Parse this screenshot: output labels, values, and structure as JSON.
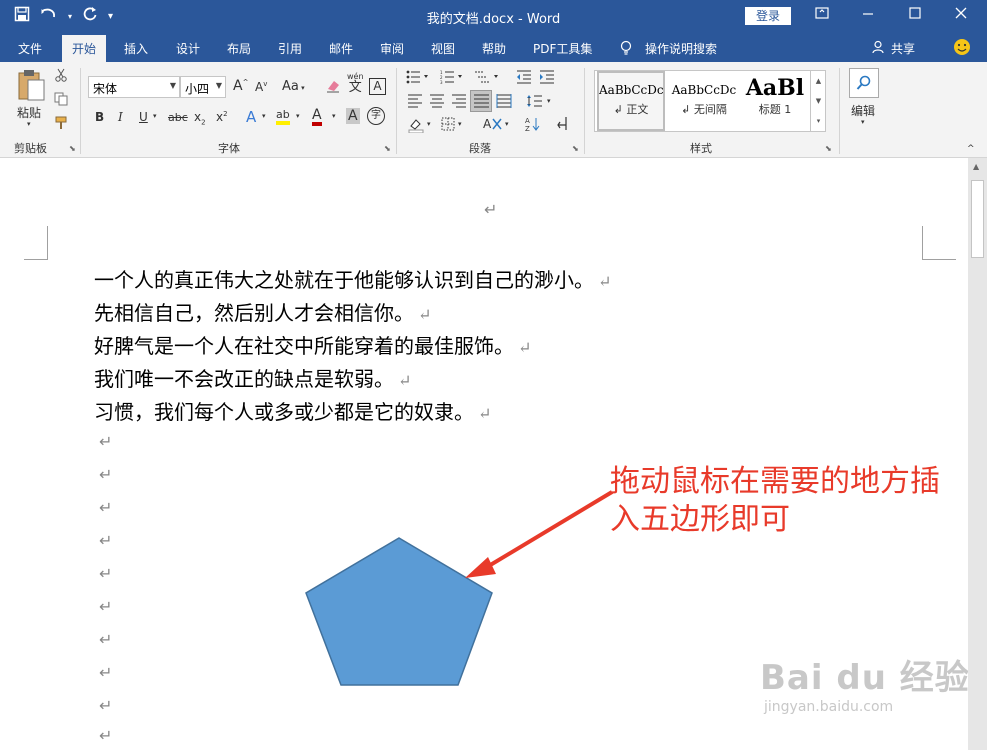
{
  "titlebar": {
    "title": "我的文档.docx  -  Word",
    "login": "登录",
    "qat_icons": [
      "save-icon",
      "undo-icon",
      "redo-icon",
      "customize-icon"
    ],
    "window_buttons": [
      "ribbon-display-icon",
      "minimize-icon",
      "maximize-icon",
      "close-icon"
    ]
  },
  "tabs": [
    "文件",
    "开始",
    "插入",
    "设计",
    "布局",
    "引用",
    "邮件",
    "审阅",
    "视图",
    "帮助",
    "PDF工具集"
  ],
  "active_tab": "开始",
  "tellme": "操作说明搜索",
  "share": "共享",
  "ribbon": {
    "clipboard": {
      "paste_label": "粘贴",
      "group_label": "剪贴板"
    },
    "font": {
      "font_name": "宋体",
      "font_size": "小四",
      "group_label": "字体",
      "wen_label": "wén",
      "wen_char": "文",
      "a_box": "A",
      "aa_label": "Aa",
      "grow": "A",
      "shrink": "A",
      "bold": "B",
      "italic": "I",
      "underline": "U",
      "strike": "abc",
      "sub": "x",
      "sup": "x",
      "effects": "A",
      "highlight": "ab",
      "color": "A",
      "shade": "A",
      "circle": "字"
    },
    "paragraph": {
      "group_label": "段落"
    },
    "styles": {
      "group_label": "样式",
      "items": [
        {
          "sample": "AaBbCcDc",
          "name": "↲ 正文"
        },
        {
          "sample": "AaBbCcDc",
          "name": "↲ 无间隔"
        },
        {
          "sample": "AaBl",
          "name": "标题 1"
        }
      ]
    },
    "editing": {
      "label": "编辑"
    }
  },
  "document": {
    "header_mark": "↵",
    "paragraphs": [
      "一个人的真正伟大之处就在于他能够认识到自己的渺小。",
      "先相信自己，然后别人才会相信你。",
      "好脾气是一个人在社交中所能穿着的最佳服饰。",
      "我们唯一不会改正的缺点是软弱。",
      "习惯，我们每个人或多或少都是它的奴隶。"
    ],
    "para_mark": "↵",
    "annotation_line1": "拖动鼠标在需要的地方插",
    "annotation_line2": "入五边形即可",
    "shape_fill": "#5b9bd5",
    "shape_stroke": "#41719c",
    "arrow_color": "#e83a2a"
  },
  "watermark": {
    "brand": "Bai du 经验",
    "url": "jingyan.baidu.com"
  }
}
